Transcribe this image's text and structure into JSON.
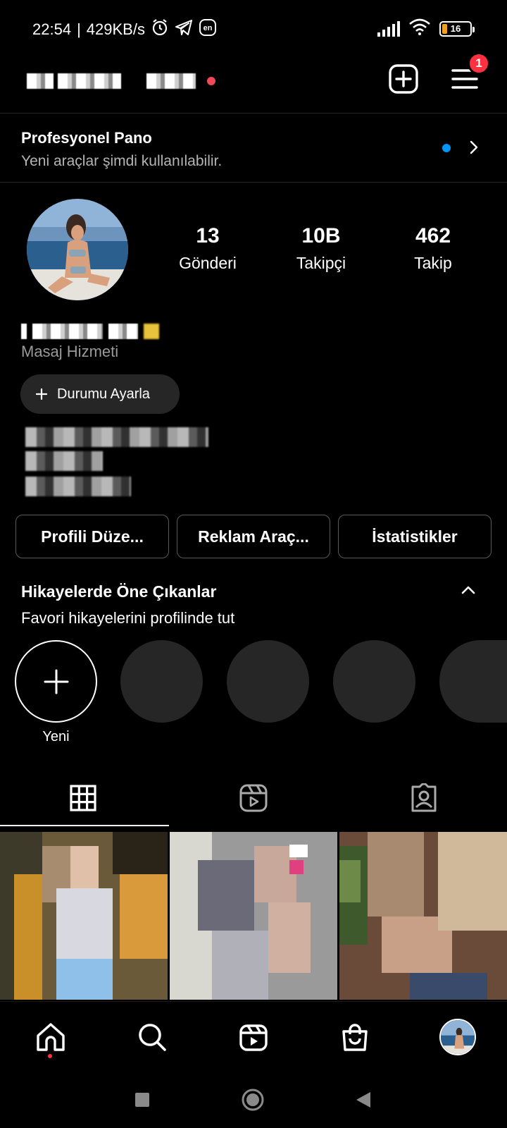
{
  "status_bar": {
    "time": "22:54",
    "separator": "|",
    "net_speed": "429KB/s",
    "battery": "16",
    "battery_level": 0.16,
    "icons": [
      "alarm-icon",
      "telegram-icon",
      "en-icon",
      "signal-icon",
      "wifi-icon",
      "battery-icon"
    ]
  },
  "header": {
    "notification_count": "1",
    "icons": [
      "new-post-icon",
      "menu-icon"
    ]
  },
  "pro_dashboard": {
    "title": "Profesyonel Pano",
    "subtitle": "Yeni araçlar şimdi kullanılabilir."
  },
  "profile": {
    "stats": [
      {
        "value": "13",
        "label": "Gönderi"
      },
      {
        "value": "10B",
        "label": "Takipçi"
      },
      {
        "value": "462",
        "label": "Takip"
      }
    ],
    "category": "Masaj Hizmeti",
    "status_button": "Durumu Ayarla"
  },
  "actions": [
    {
      "label": "Profili Düze..."
    },
    {
      "label": "Reklam Araç..."
    },
    {
      "label": "İstatistikler"
    }
  ],
  "highlights": {
    "title": "Hikayelerde Öne Çıkanlar",
    "subtitle": "Favori hikayelerini profilinde tut",
    "new_label": "Yeni"
  },
  "tabs": [
    "grid-icon",
    "reels-icon",
    "tagged-icon"
  ],
  "bottom_nav": [
    "home-icon",
    "search-icon",
    "reels-icon",
    "shop-icon",
    "profile-avatar"
  ],
  "colors": {
    "background": "#000000",
    "accent_blue": "#0095f6",
    "notification_red": "#ff3040",
    "button_border": "#5a5a5a",
    "pill_bg": "#262626"
  }
}
